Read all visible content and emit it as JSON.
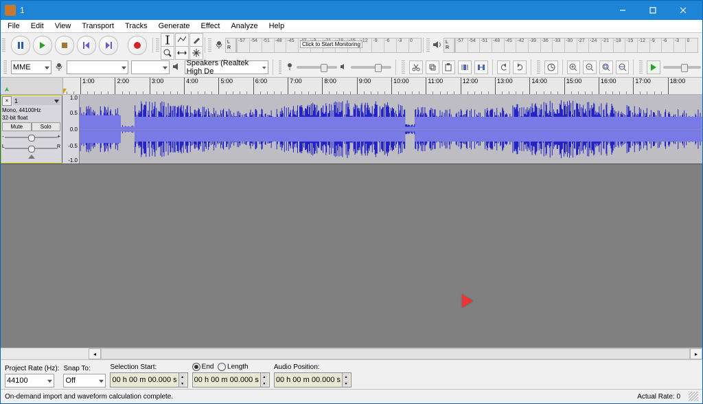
{
  "window": {
    "title": "1"
  },
  "menu": [
    "File",
    "Edit",
    "View",
    "Transport",
    "Tracks",
    "Generate",
    "Effect",
    "Analyze",
    "Help"
  ],
  "rec_meter": {
    "click_text": "Click to Start Monitoring",
    "ticks": [
      "-57",
      "-54",
      "-51",
      "-48",
      "-45",
      "-42",
      "-3",
      "-21",
      "-18",
      "-15",
      "-12",
      "-9",
      "-6",
      "-3",
      "0"
    ]
  },
  "play_meter": {
    "ticks": [
      "-57",
      "-54",
      "-51",
      "-48",
      "-45",
      "-42",
      "-39",
      "-36",
      "-33",
      "-30",
      "-27",
      "-24",
      "-21",
      "-18",
      "-15",
      "-12",
      "-9",
      "-6",
      "-3",
      "0"
    ]
  },
  "device_bar": {
    "host": "MME",
    "output": "Speakers (Realtek High De"
  },
  "timeline": {
    "labels": [
      "1:00",
      "2:00",
      "3:00",
      "4:00",
      "5:00",
      "6:00",
      "7:00",
      "8:00",
      "9:00",
      "10:00",
      "11:00",
      "12:00",
      "13:00",
      "14:00",
      "15:00",
      "16:00",
      "17:00",
      "18:00"
    ]
  },
  "track": {
    "name": "1",
    "info1": "Mono, 44100Hz",
    "info2": "32-bit float",
    "mute": "Mute",
    "solo": "Solo",
    "pan_l": "L",
    "pan_r": "R",
    "vscale": [
      "1.0",
      "0.5",
      "0.0",
      "-0.5",
      "-1.0"
    ],
    "gain_dash": "-",
    "gain_plus": "+"
  },
  "selection_bar": {
    "project_rate_label": "Project Rate (Hz):",
    "project_rate": "44100",
    "snap_label": "Snap To:",
    "snap": "Off",
    "sel_start_label": "Selection Start:",
    "end_label": "End",
    "length_label": "Length",
    "audio_pos_label": "Audio Position:",
    "time_display": "00 h 00 m 00.000 s"
  },
  "status": {
    "message": "On-demand import and waveform calculation complete.",
    "actual_rate": "Actual Rate: 0"
  }
}
